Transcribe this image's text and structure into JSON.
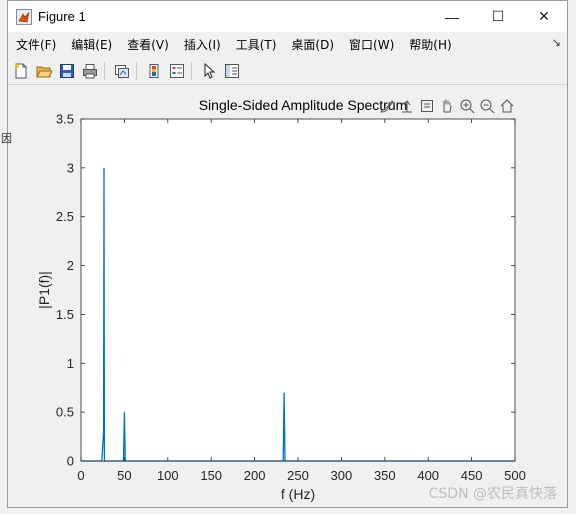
{
  "window": {
    "title": "Figure 1",
    "controls": {
      "minimize": "—",
      "maximize": "☐",
      "close": "✕"
    }
  },
  "menu": {
    "items": [
      "文件(F)",
      "编辑(E)",
      "查看(V)",
      "插入(I)",
      "工具(T)",
      "桌面(D)",
      "窗口(W)",
      "帮助(H)"
    ],
    "overflow_icon": "dock-arrow-icon"
  },
  "toolbar": {
    "buttons": [
      "new-figure-icon",
      "open-file-icon",
      "save-icon",
      "print-icon",
      "link-plot-icon",
      "insert-colorbar-icon",
      "insert-legend-icon",
      "edit-plot-icon",
      "property-inspector-icon"
    ]
  },
  "axes_toolbar": {
    "buttons": [
      "brush-icon",
      "data-tips-icon",
      "export-icon",
      "pan-icon",
      "zoom-in-icon",
      "zoom-out-icon",
      "home-icon"
    ]
  },
  "watermark": "CSDN @农民真快落",
  "stray_glyph": "因",
  "colors": {
    "series": "#0072bd",
    "axes": "#262626",
    "plot_bg": "#ffffff",
    "figure_bg": "#f0f0f0"
  },
  "chart_data": {
    "type": "line",
    "title": "Single-Sided Amplitude Spectrum",
    "xlabel": "f (Hz)",
    "ylabel": "|P1(f)|",
    "xlim": [
      0,
      500
    ],
    "ylim": [
      0,
      3.5
    ],
    "xticks": [
      0,
      50,
      100,
      150,
      200,
      250,
      300,
      350,
      400,
      450,
      500
    ],
    "yticks": [
      0,
      0.5,
      1,
      1.5,
      2,
      2.5,
      3,
      3.5
    ],
    "grid": false,
    "series": [
      {
        "x": [
          0,
          24,
          26,
          26.5,
          27,
          49,
          50,
          51,
          233,
          234,
          235,
          500
        ],
        "y": [
          0,
          0,
          0.3,
          3.0,
          0,
          0,
          0.5,
          0,
          0,
          0.7,
          0,
          0
        ]
      }
    ]
  }
}
